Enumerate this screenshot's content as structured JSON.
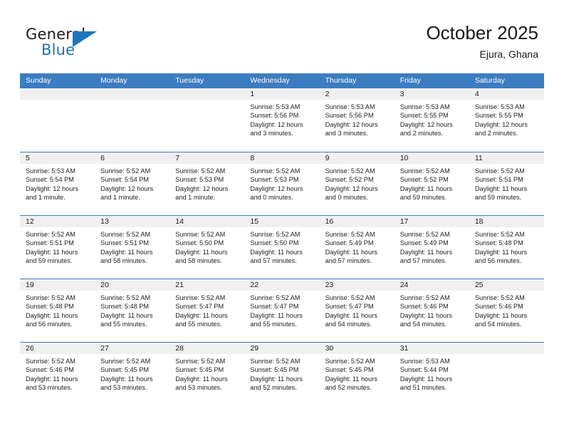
{
  "logo": {
    "word1": "General",
    "word2": "Blue",
    "accent_color": "#1b75bb",
    "triangle_icon": "triangle-icon"
  },
  "header": {
    "title": "October 2025",
    "location": "Ejura, Ghana"
  },
  "calendar": {
    "header_bg": "#3c7cc0",
    "daynum_bg": "#f0f0f0",
    "weekdays": [
      "Sunday",
      "Monday",
      "Tuesday",
      "Wednesday",
      "Thursday",
      "Friday",
      "Saturday"
    ],
    "weeks": [
      [
        {
          "day": "",
          "empty": true
        },
        {
          "day": "",
          "empty": true
        },
        {
          "day": "",
          "empty": true
        },
        {
          "day": "1",
          "sunrise": "Sunrise: 5:53 AM",
          "sunset": "Sunset: 5:56 PM",
          "daylight1": "Daylight: 12 hours",
          "daylight2": "and 3 minutes."
        },
        {
          "day": "2",
          "sunrise": "Sunrise: 5:53 AM",
          "sunset": "Sunset: 5:56 PM",
          "daylight1": "Daylight: 12 hours",
          "daylight2": "and 3 minutes."
        },
        {
          "day": "3",
          "sunrise": "Sunrise: 5:53 AM",
          "sunset": "Sunset: 5:55 PM",
          "daylight1": "Daylight: 12 hours",
          "daylight2": "and 2 minutes."
        },
        {
          "day": "4",
          "sunrise": "Sunrise: 5:53 AM",
          "sunset": "Sunset: 5:55 PM",
          "daylight1": "Daylight: 12 hours",
          "daylight2": "and 2 minutes."
        }
      ],
      [
        {
          "day": "5",
          "sunrise": "Sunrise: 5:53 AM",
          "sunset": "Sunset: 5:54 PM",
          "daylight1": "Daylight: 12 hours",
          "daylight2": "and 1 minute."
        },
        {
          "day": "6",
          "sunrise": "Sunrise: 5:52 AM",
          "sunset": "Sunset: 5:54 PM",
          "daylight1": "Daylight: 12 hours",
          "daylight2": "and 1 minute."
        },
        {
          "day": "7",
          "sunrise": "Sunrise: 5:52 AM",
          "sunset": "Sunset: 5:53 PM",
          "daylight1": "Daylight: 12 hours",
          "daylight2": "and 1 minute."
        },
        {
          "day": "8",
          "sunrise": "Sunrise: 5:52 AM",
          "sunset": "Sunset: 5:53 PM",
          "daylight1": "Daylight: 12 hours",
          "daylight2": "and 0 minutes."
        },
        {
          "day": "9",
          "sunrise": "Sunrise: 5:52 AM",
          "sunset": "Sunset: 5:52 PM",
          "daylight1": "Daylight: 12 hours",
          "daylight2": "and 0 minutes."
        },
        {
          "day": "10",
          "sunrise": "Sunrise: 5:52 AM",
          "sunset": "Sunset: 5:52 PM",
          "daylight1": "Daylight: 11 hours",
          "daylight2": "and 59 minutes."
        },
        {
          "day": "11",
          "sunrise": "Sunrise: 5:52 AM",
          "sunset": "Sunset: 5:51 PM",
          "daylight1": "Daylight: 11 hours",
          "daylight2": "and 59 minutes."
        }
      ],
      [
        {
          "day": "12",
          "sunrise": "Sunrise: 5:52 AM",
          "sunset": "Sunset: 5:51 PM",
          "daylight1": "Daylight: 11 hours",
          "daylight2": "and 59 minutes."
        },
        {
          "day": "13",
          "sunrise": "Sunrise: 5:52 AM",
          "sunset": "Sunset: 5:51 PM",
          "daylight1": "Daylight: 11 hours",
          "daylight2": "and 58 minutes."
        },
        {
          "day": "14",
          "sunrise": "Sunrise: 5:52 AM",
          "sunset": "Sunset: 5:50 PM",
          "daylight1": "Daylight: 11 hours",
          "daylight2": "and 58 minutes."
        },
        {
          "day": "15",
          "sunrise": "Sunrise: 5:52 AM",
          "sunset": "Sunset: 5:50 PM",
          "daylight1": "Daylight: 11 hours",
          "daylight2": "and 57 minutes."
        },
        {
          "day": "16",
          "sunrise": "Sunrise: 5:52 AM",
          "sunset": "Sunset: 5:49 PM",
          "daylight1": "Daylight: 11 hours",
          "daylight2": "and 57 minutes."
        },
        {
          "day": "17",
          "sunrise": "Sunrise: 5:52 AM",
          "sunset": "Sunset: 5:49 PM",
          "daylight1": "Daylight: 11 hours",
          "daylight2": "and 57 minutes."
        },
        {
          "day": "18",
          "sunrise": "Sunrise: 5:52 AM",
          "sunset": "Sunset: 5:48 PM",
          "daylight1": "Daylight: 11 hours",
          "daylight2": "and 56 minutes."
        }
      ],
      [
        {
          "day": "19",
          "sunrise": "Sunrise: 5:52 AM",
          "sunset": "Sunset: 5:48 PM",
          "daylight1": "Daylight: 11 hours",
          "daylight2": "and 56 minutes."
        },
        {
          "day": "20",
          "sunrise": "Sunrise: 5:52 AM",
          "sunset": "Sunset: 5:48 PM",
          "daylight1": "Daylight: 11 hours",
          "daylight2": "and 55 minutes."
        },
        {
          "day": "21",
          "sunrise": "Sunrise: 5:52 AM",
          "sunset": "Sunset: 5:47 PM",
          "daylight1": "Daylight: 11 hours",
          "daylight2": "and 55 minutes."
        },
        {
          "day": "22",
          "sunrise": "Sunrise: 5:52 AM",
          "sunset": "Sunset: 5:47 PM",
          "daylight1": "Daylight: 11 hours",
          "daylight2": "and 55 minutes."
        },
        {
          "day": "23",
          "sunrise": "Sunrise: 5:52 AM",
          "sunset": "Sunset: 5:47 PM",
          "daylight1": "Daylight: 11 hours",
          "daylight2": "and 54 minutes."
        },
        {
          "day": "24",
          "sunrise": "Sunrise: 5:52 AM",
          "sunset": "Sunset: 5:46 PM",
          "daylight1": "Daylight: 11 hours",
          "daylight2": "and 54 minutes."
        },
        {
          "day": "25",
          "sunrise": "Sunrise: 5:52 AM",
          "sunset": "Sunset: 5:46 PM",
          "daylight1": "Daylight: 11 hours",
          "daylight2": "and 54 minutes."
        }
      ],
      [
        {
          "day": "26",
          "sunrise": "Sunrise: 5:52 AM",
          "sunset": "Sunset: 5:46 PM",
          "daylight1": "Daylight: 11 hours",
          "daylight2": "and 53 minutes."
        },
        {
          "day": "27",
          "sunrise": "Sunrise: 5:52 AM",
          "sunset": "Sunset: 5:45 PM",
          "daylight1": "Daylight: 11 hours",
          "daylight2": "and 53 minutes."
        },
        {
          "day": "28",
          "sunrise": "Sunrise: 5:52 AM",
          "sunset": "Sunset: 5:45 PM",
          "daylight1": "Daylight: 11 hours",
          "daylight2": "and 53 minutes."
        },
        {
          "day": "29",
          "sunrise": "Sunrise: 5:52 AM",
          "sunset": "Sunset: 5:45 PM",
          "daylight1": "Daylight: 11 hours",
          "daylight2": "and 52 minutes."
        },
        {
          "day": "30",
          "sunrise": "Sunrise: 5:52 AM",
          "sunset": "Sunset: 5:45 PM",
          "daylight1": "Daylight: 11 hours",
          "daylight2": "and 52 minutes."
        },
        {
          "day": "31",
          "sunrise": "Sunrise: 5:53 AM",
          "sunset": "Sunset: 5:44 PM",
          "daylight1": "Daylight: 11 hours",
          "daylight2": "and 51 minutes."
        },
        {
          "day": "",
          "empty": true
        }
      ]
    ]
  }
}
